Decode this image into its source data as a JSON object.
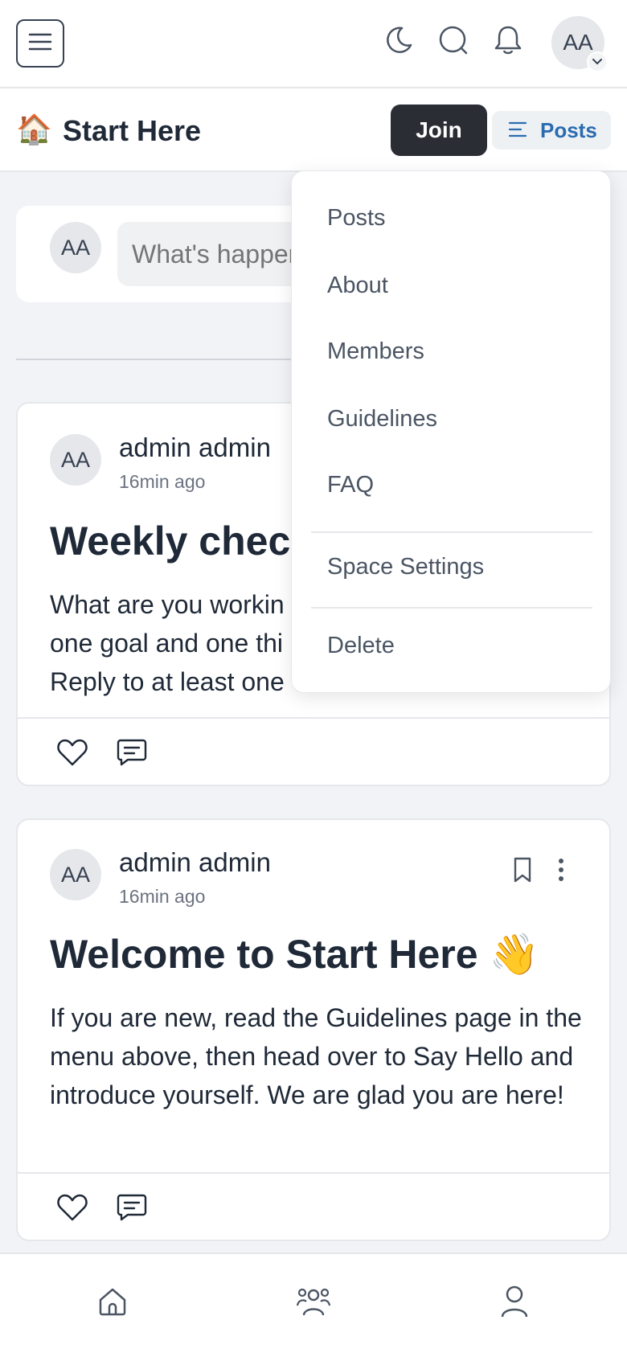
{
  "topbar": {
    "menu_icon": "hamburger-icon",
    "theme_icon": "moon-icon",
    "search_icon": "search-icon",
    "notifications_icon": "bell-icon",
    "user_initials": "AA",
    "caret_icon": "chevron-down-icon"
  },
  "space": {
    "emoji": "🏠",
    "title": "Start Here",
    "join_label": "Join",
    "view_label": "Posts"
  },
  "composer": {
    "avatar_initials": "AA",
    "placeholder": "What's happening?"
  },
  "dropdown": {
    "items": [
      "Posts",
      "About",
      "Members",
      "Guidelines",
      "FAQ"
    ],
    "settings": "Space Settings",
    "delete": "Delete"
  },
  "posts": [
    {
      "initials": "AA",
      "author": "admin admin",
      "time": "16min ago",
      "title": "Weekly check",
      "body": "What are you workin one goal and one thi Reply to at least one"
    },
    {
      "initials": "AA",
      "author": "admin admin",
      "time": "16min ago",
      "title": "Welcome to Start Here 👋",
      "body": "If you are new, read the Guidelines page in the menu above, then head over to Say Hello and introduce yourself. We are glad you are here!"
    }
  ],
  "bottom_nav": {
    "home_icon": "home-icon",
    "members_icon": "people-icon",
    "profile_icon": "user-icon"
  },
  "colors": {
    "accent": "#2a6cb0",
    "join_bg": "#2a2d33",
    "page_bg": "#f1f3f6"
  }
}
